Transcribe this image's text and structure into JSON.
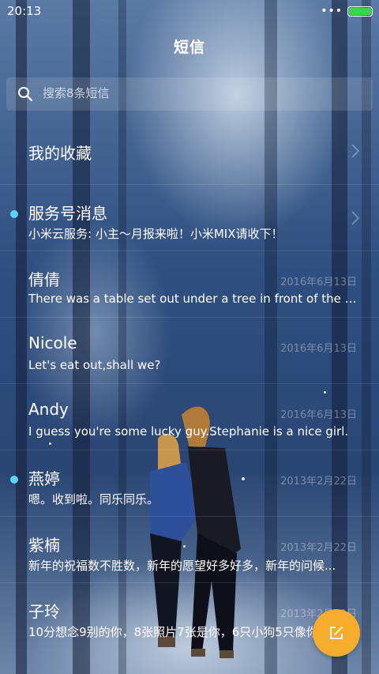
{
  "status_bar": {
    "time": "20:13",
    "dots": "•••"
  },
  "header": {
    "title": "短信"
  },
  "search": {
    "placeholder": "搜索8条短信"
  },
  "favorites": {
    "label": "我的收藏"
  },
  "conversations": [
    {
      "name": "服务号消息",
      "preview": "小米云服务: 小主～月报来啦！小米MIX请收下！",
      "date": "",
      "unread": true,
      "has_chevron": true
    },
    {
      "name": "倩倩",
      "preview": "There was a table set out under a tree in front of the ho...",
      "date": "2016年6月13日",
      "unread": false
    },
    {
      "name": "Nicole",
      "preview": "Let's eat out,shall we?",
      "date": "2016年6月13日",
      "unread": false
    },
    {
      "name": "Andy",
      "preview": "I guess you're some lucky guy.Stephanie is a nice girl.",
      "date": "2016年6月13日",
      "unread": false
    },
    {
      "name": "燕婷",
      "preview": "嗯。收到啦。同乐同乐。",
      "date": "2013年2月22日",
      "unread": true
    },
    {
      "name": "紫楠",
      "preview": "新年的祝福数不胜数，新年的愿望好多好多，新年的问候...",
      "date": "2013年2月22日",
      "unread": false
    },
    {
      "name": "子玲",
      "preview": "10分想念9别的你，8张照片7张是你，6只小狗5只像你",
      "date": "2013年2月22日",
      "unread": false
    }
  ],
  "colors": {
    "accent": "#f6ad2e",
    "unread_dot": "#5ed4ff",
    "battery": "#3fd24a"
  }
}
